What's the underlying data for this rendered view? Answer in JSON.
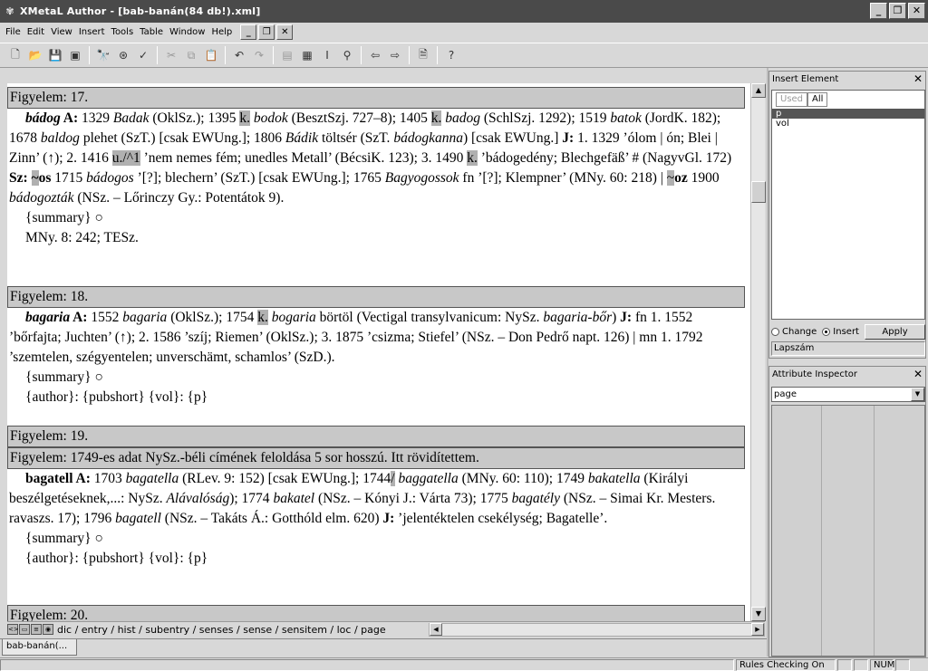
{
  "window": {
    "title": "XMetaL Author - [bab-banán(84 db!).xml]"
  },
  "menu": [
    "File",
    "Edit",
    "View",
    "Insert",
    "Tools",
    "Table",
    "Window",
    "Help"
  ],
  "document": {
    "entries": [
      {
        "header": "Figyelem: 17.",
        "paragraph_html": "<b><i>bádog</i> A:</b> 1329 <i>Badak</i> (OklSz.); 1395 <span class='hl'>k.</span> <i>bodok</i> (BesztSzj. 727–8); 1405 <span class='hl'>k.</span> <i>badog</i> (SchlSzj. 1292); 1519 <i>batok</i> (JordK. 182); 1678 <i>baldog</i> plehet (SzT.) [csak EWUng.]; 1806 <i>Bádik</i> töltsér (SzT. <i>bádogkanna</i>) [csak EWUng.] <b>J:</b> 1. 1329 ’ólom | ón; Blei | Zinn’ (↑); 2. 1416 <span class='hl'>u./^1</span> ’nem nemes fém; unedles Metall’ (BécsiK. 123); 3. 1490 <span class='hl'>k.</span> ’bádogedény; Blechgefäß’ # (NagyvGl. 172) <b>Sz: <span class='hl'>~</span>os</b> 1715 <i>bádogos</i> ’[?]; blechern’ (SzT.) [csak EWUng.]; 1765 <i>Bagyogossok</i> fn ’[?]; Klempner’ (MNy. 60: 218) | <span class='hl'>~</span><b>oz</b> 1900 <i>bádogozták</i> (NSz. – Lőrinczy Gy.: Potentátok 9).",
        "lines": [
          "{summary} ○",
          "MNy. 8: 242; TESz."
        ]
      },
      {
        "header": "Figyelem: 18.",
        "paragraph_html": "<b><i>bagaria</i> A:</b> 1552 <i>bagaria</i> (OklSz.); 1754 <span class='hl'>k.</span> <i>bogaria</i> börtöl (Vectigal transylvanicum: NySz. <i>bagaria-bőr</i>) <b>J:</b> fn 1. 1552 ’bőrfajta; Juchten’ (↑); 2. 1586 ’szíj; Riemen’ (OklSz.); 3. 1875 ’csizma; Stiefel’ (NSz. – Don Pedrő napt. 126) | mn 1. 1792 ’szemtelen, szégyentelen; unverschämt, schamlos’ (SzD.).",
        "lines": [
          "{summary} ○",
          "{author}: {pubshort} {vol}: {p}"
        ]
      },
      {
        "header": "Figyelem: 19.",
        "header2": "Figyelem: 1749-es adat NySz.-béli címének feloldása 5 sor hosszú. Itt rövidítettem.",
        "paragraph_html": "<b>bagatell A:</b> 1703 <i>bagatella</i> (RLev. 9: 152) [csak EWUng.]; 1744<span class='hl'>/</span> <i>baggatella</i> (MNy. 60: 110); 1749 <i>bakatella</i> (Királyi beszélgetéseknek,...: NySz. <i>Alávalóság</i>); 1774 <i>bakatel</i> (NSz. – Kónyi J.: Várta 73); 1775 <i>bagatély</i> (NSz. – Simai Kr. Mesters. ravaszs. 17); 1796 <i>bagatell</i> (NSz. – Takáts Á.: Gotthóld elm. 620) <b>J:</b> ’jelentéktelen csekélység; Bagatelle’.",
        "lines": [
          "{summary} ○",
          "{author}: {pubshort} {vol}: {p}"
        ]
      },
      {
        "header": "Figyelem: 20."
      }
    ]
  },
  "path_bar": "dic / entry / hist / subentry / senses / sense / sensitem / loc / page",
  "doc_tab": "bab-banán(...",
  "status": {
    "rules": "Rules Checking On",
    "num": "NUM"
  },
  "insert_element": {
    "title": "Insert Element",
    "tabs": [
      "Used",
      "All"
    ],
    "items": [
      "p",
      "vol"
    ],
    "selected_item": "p",
    "radio_change": "Change",
    "radio_insert": "Insert",
    "apply": "Apply",
    "footer": "Lapszám"
  },
  "attribute_inspector": {
    "title": "Attribute Inspector",
    "selected": "page"
  }
}
